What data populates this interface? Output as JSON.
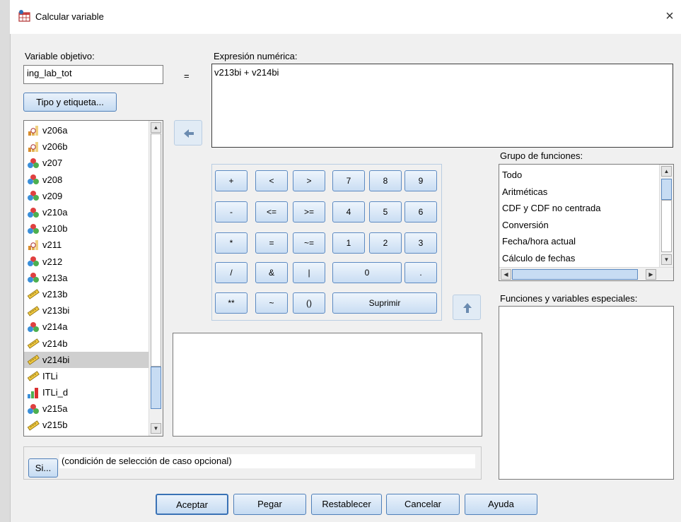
{
  "window": {
    "title": "Calcular variable",
    "close": "×"
  },
  "target": {
    "label": "Variable objetivo:",
    "value": "ing_lab_tot",
    "equals": "=",
    "type_button": "Tipo y etiqueta..."
  },
  "expression": {
    "label": "Expresión numérica:",
    "value": "v213bi + v214bi"
  },
  "variables": [
    {
      "name": "v206a",
      "icon": "ordinal-icon"
    },
    {
      "name": "v206b",
      "icon": "ordinal-icon"
    },
    {
      "name": "v207",
      "icon": "nominal-icon"
    },
    {
      "name": "v208",
      "icon": "nominal-icon"
    },
    {
      "name": "v209",
      "icon": "nominal-icon"
    },
    {
      "name": "v210a",
      "icon": "nominal-icon"
    },
    {
      "name": "v210b",
      "icon": "nominal-icon"
    },
    {
      "name": "v211",
      "icon": "ordinal-icon"
    },
    {
      "name": "v212",
      "icon": "nominal-icon"
    },
    {
      "name": "v213a",
      "icon": "nominal-icon"
    },
    {
      "name": "v213b",
      "icon": "scale-icon"
    },
    {
      "name": "v213bi",
      "icon": "scale-icon"
    },
    {
      "name": "v214a",
      "icon": "nominal-icon"
    },
    {
      "name": "v214b",
      "icon": "scale-icon"
    },
    {
      "name": "v214bi",
      "icon": "scale-icon",
      "selected": true
    },
    {
      "name": "ITLi",
      "icon": "scale-icon"
    },
    {
      "name": "ITLi_d",
      "icon": "bar-icon"
    },
    {
      "name": "v215a",
      "icon": "nominal-icon"
    },
    {
      "name": "v215b",
      "icon": "scale-icon"
    }
  ],
  "keypad": {
    "row1": [
      "+",
      "<",
      ">",
      "7",
      "8",
      "9"
    ],
    "row2": [
      "-",
      "<=",
      ">=",
      "4",
      "5",
      "6"
    ],
    "row3": [
      "*",
      "=",
      "~=",
      "1",
      "2",
      "3"
    ],
    "row4": [
      "/",
      "&",
      "|",
      "0",
      "."
    ],
    "row5": [
      "**",
      "~",
      "()",
      "Suprimir"
    ]
  },
  "function_group": {
    "label": "Grupo de funciones:",
    "items": [
      "Todo",
      "Aritméticas",
      "CDF y CDF no centrada",
      "Conversión",
      "Fecha/hora actual",
      "Cálculo de fechas"
    ]
  },
  "special_functions": {
    "label": "Funciones y variables especiales:"
  },
  "if_condition": {
    "button": "Si...",
    "text": "(condición de selección de caso opcional)"
  },
  "buttons": {
    "ok": "Aceptar",
    "paste": "Pegar",
    "reset": "Restablecer",
    "cancel": "Cancelar",
    "help": "Ayuda"
  },
  "colors": {
    "button_border": "#4f7fb8",
    "selection": "#cfcfcf",
    "thumb": "#c7dcf3"
  }
}
